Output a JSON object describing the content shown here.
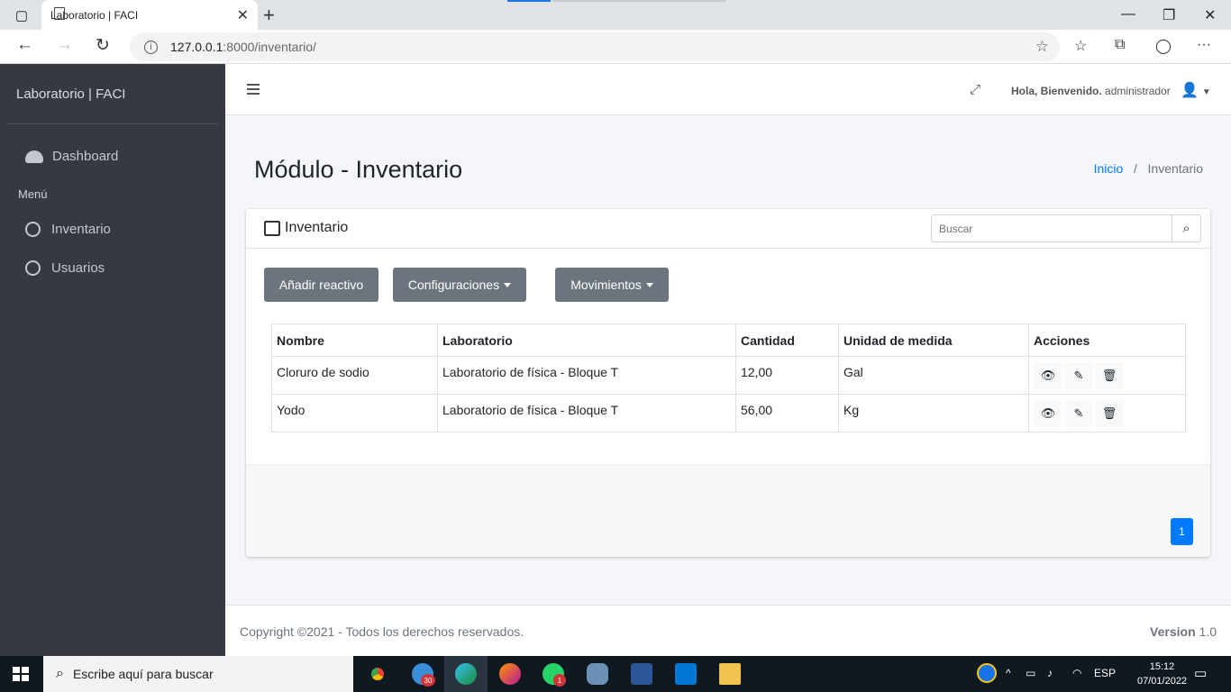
{
  "browser": {
    "tab_title": "Laboratorio | FACI",
    "url_host": "127.0.0.1",
    "url_path": ":8000/inventario/"
  },
  "sidebar": {
    "brand": "Laboratorio | FACI",
    "dashboard": "Dashboard",
    "menu_header": "Menú",
    "items": [
      {
        "label": "Inventario"
      },
      {
        "label": "Usuarios"
      }
    ]
  },
  "topnav": {
    "greeting_bold": "Hola, Bienvenido.",
    "username": "administrador"
  },
  "page": {
    "title": "Módulo - Inventario",
    "breadcrumb": {
      "home": "Inicio",
      "separator": "/",
      "current": "Inventario"
    }
  },
  "card": {
    "title": "Inventario",
    "search_placeholder": "Buscar",
    "buttons": {
      "add": "Añadir reactivo",
      "config": "Configuraciones",
      "moves": "Movimientos"
    },
    "table": {
      "headers": [
        "Nombre",
        "Laboratorio",
        "Cantidad",
        "Unidad de medida",
        "Acciones"
      ],
      "rows": [
        [
          "Cloruro de sodio",
          "Laboratorio de física - Bloque T",
          "12,00",
          "Gal"
        ],
        [
          "Yodo",
          "Laboratorio de física - Bloque T",
          "56,00",
          "Kg"
        ]
      ]
    },
    "pagination": {
      "current": "1"
    }
  },
  "footer": {
    "copyright": "Copyright ©2021 - Todos los derechos reservados.",
    "version_label": "Version",
    "version_value": "1.0"
  },
  "taskbar": {
    "search_placeholder": "Escribe aquí para buscar",
    "badge_mail": "30",
    "badge_whatsapp": "1",
    "language": "ESP",
    "time": "15:12",
    "date": "07/01/2022"
  },
  "colors": {
    "sidebar_bg": "#343a40",
    "primary": "#007bff",
    "secondary_btn": "#6c757d",
    "content_bg": "#f4f6f9"
  }
}
